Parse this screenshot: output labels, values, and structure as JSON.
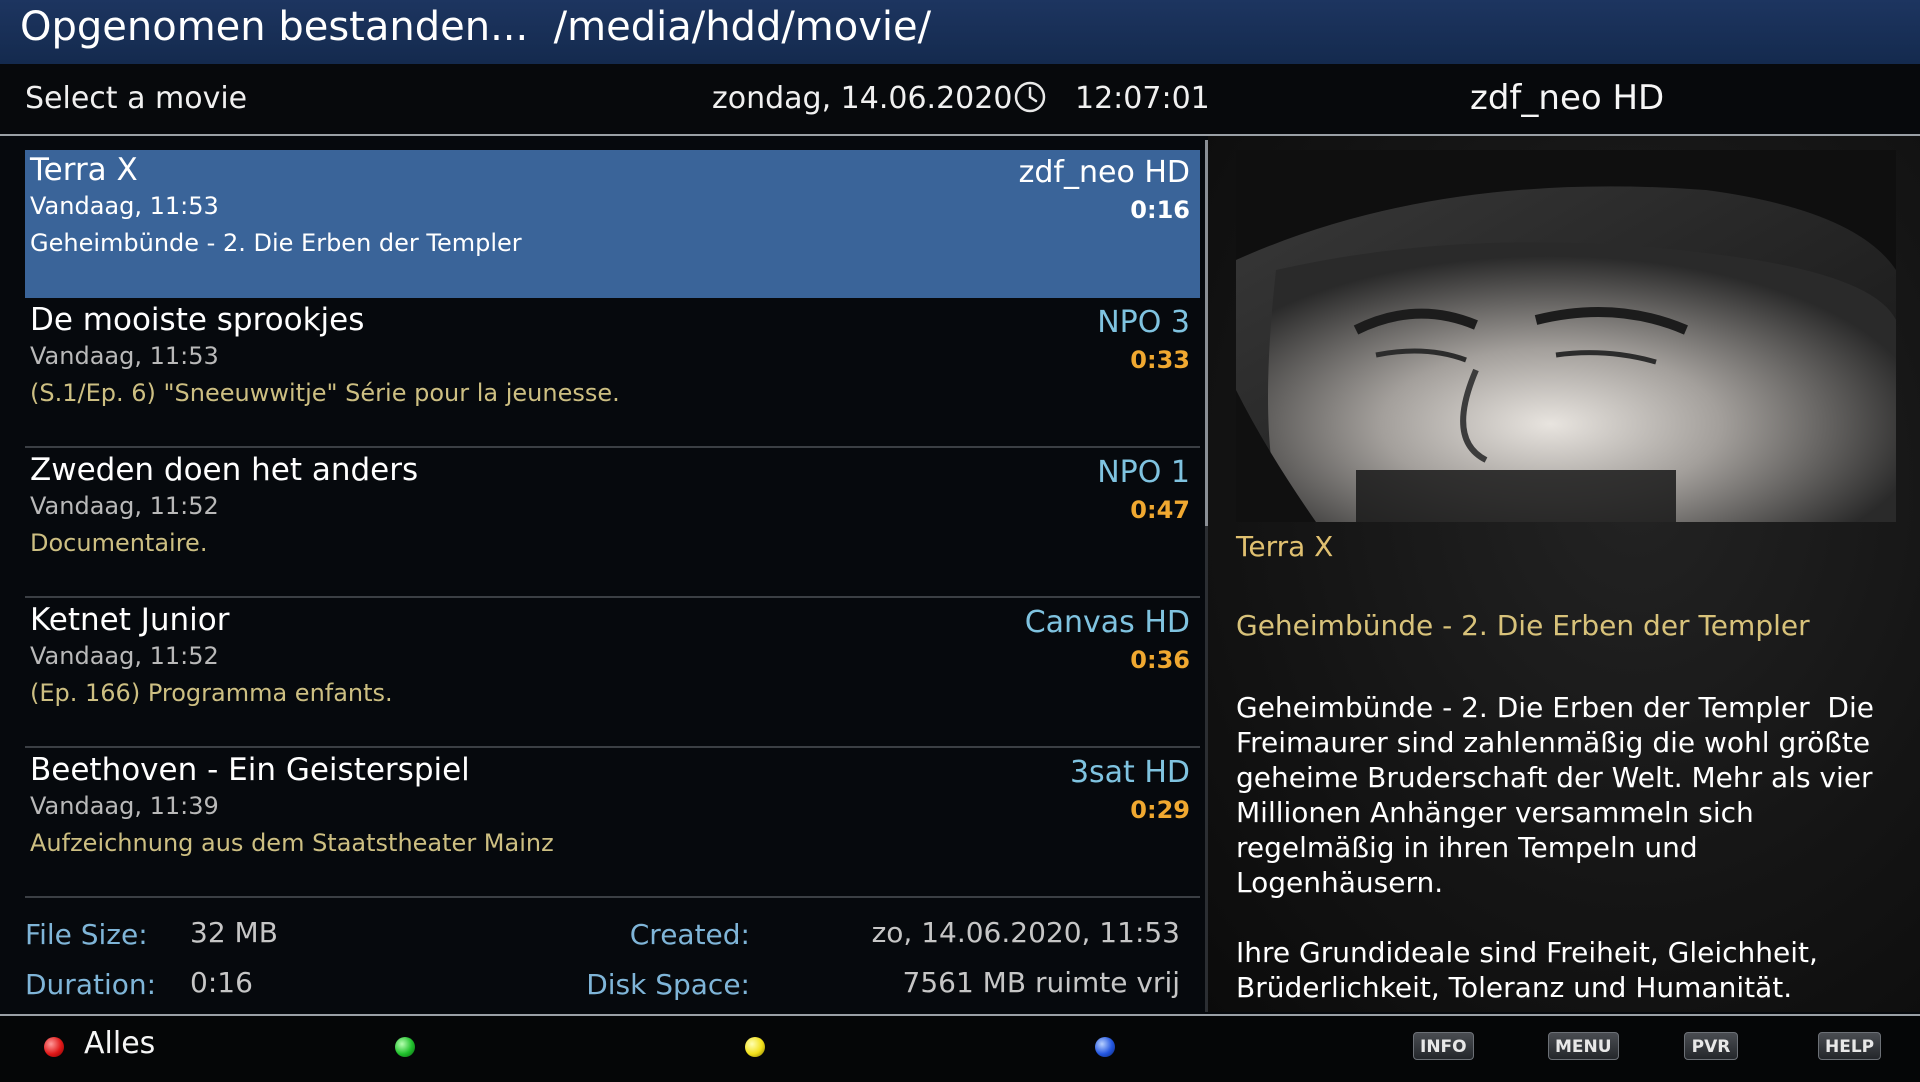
{
  "header": {
    "title": "Opgenomen bestanden...  /media/hdd/movie/"
  },
  "infobar": {
    "subtitle": "Select a movie",
    "date": "zondag, 14.06.2020",
    "time": "12:07:01",
    "channel": "zdf_neo HD",
    "clock_icon": "clock-icon"
  },
  "movies": [
    {
      "title": "Terra X",
      "date": "Vandaag, 11:53",
      "description": "Geheimbünde - 2. Die Erben der Templer",
      "channel": "zdf_neo HD",
      "duration": "0:16",
      "selected": true
    },
    {
      "title": "De mooiste sprookjes",
      "date": "Vandaag, 11:53",
      "description": "(S.1/Ep. 6) \"Sneeuwwitje\" Série pour la jeunesse.",
      "channel": "NPO 3",
      "duration": "0:33",
      "selected": false
    },
    {
      "title": "Zweden doen het anders",
      "date": "Vandaag, 11:52",
      "description": "Documentaire.",
      "channel": "NPO 1",
      "duration": "0:47",
      "selected": false
    },
    {
      "title": "Ketnet Junior",
      "date": "Vandaag, 11:52",
      "description": "(Ep. 166) Programma enfants.",
      "channel": "Canvas HD",
      "duration": "0:36",
      "selected": false
    },
    {
      "title": "Beethoven - Ein Geisterspiel",
      "date": "Vandaag, 11:39",
      "description": "Aufzeichnung aus dem Staatstheater Mainz",
      "channel": "3sat HD",
      "duration": "0:29",
      "selected": false
    }
  ],
  "fileinfo": {
    "size_label": "File Size:",
    "size_value": "32 MB",
    "duration_label": "Duration:",
    "duration_value": "0:16",
    "created_label": "Created:",
    "created_value": "zo, 14.06.2020,  11:53",
    "disk_label": "Disk Space:",
    "disk_value": "7561 MB ruimte vrij"
  },
  "details": {
    "title": "Terra X",
    "subtitle": "Geheimbünde - 2. Die Erben der Templer",
    "description_1": "Geheimbünde - 2. Die Erben der Templer  Die Freimaurer sind zahlenmäßig die wohl größte geheime Bruderschaft der Welt. Mehr als vier Millionen Anhänger versammeln sich regelmäßig in ihren Tempeln und Logenhäusern.",
    "description_2": "Ihre Grundideale sind Freiheit, Gleichheit, Brüderlichkeit, Toleranz und Humanität."
  },
  "buttons": {
    "red_label": "Alles",
    "keys": [
      "INFO",
      "MENU",
      "PVR",
      "HELP"
    ]
  },
  "colors": {
    "title_bg": "#1d3560",
    "selection": "#3a6499",
    "channel": "#7fc3e0",
    "duration": "#f0a830",
    "description": "#cdbf82",
    "label": "#7fb5d8"
  }
}
